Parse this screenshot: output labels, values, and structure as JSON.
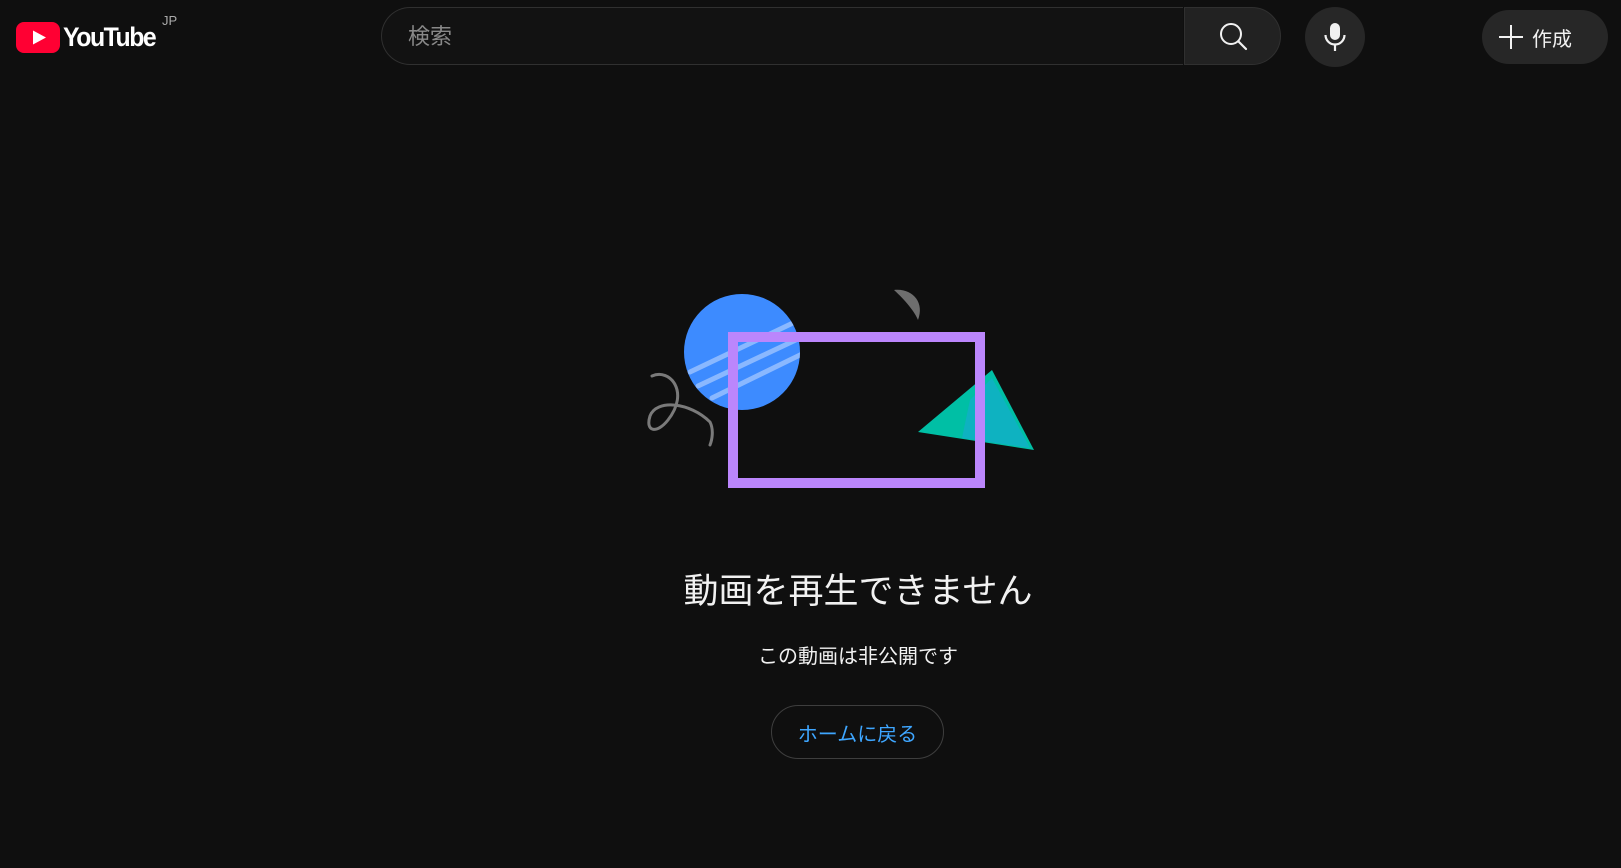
{
  "header": {
    "logo_text": "YouTube",
    "region_code": "JP",
    "search": {
      "placeholder": "検索",
      "value": ""
    },
    "search_icon": "search-icon",
    "mic_icon": "microphone-icon",
    "create_label": "作成",
    "create_icon": "plus-icon"
  },
  "main": {
    "title": "動画を再生できません",
    "subtitle": "この動画は非公開です",
    "home_button_label": "ホームに戻る"
  },
  "colors": {
    "background": "#0f0f0f",
    "brand_red": "#ff0033",
    "link_blue": "#3ea6ff",
    "illustration_purple": "#bb86fc",
    "illustration_blue": "#3d8bff",
    "illustration_teal": "#00bfa5"
  }
}
